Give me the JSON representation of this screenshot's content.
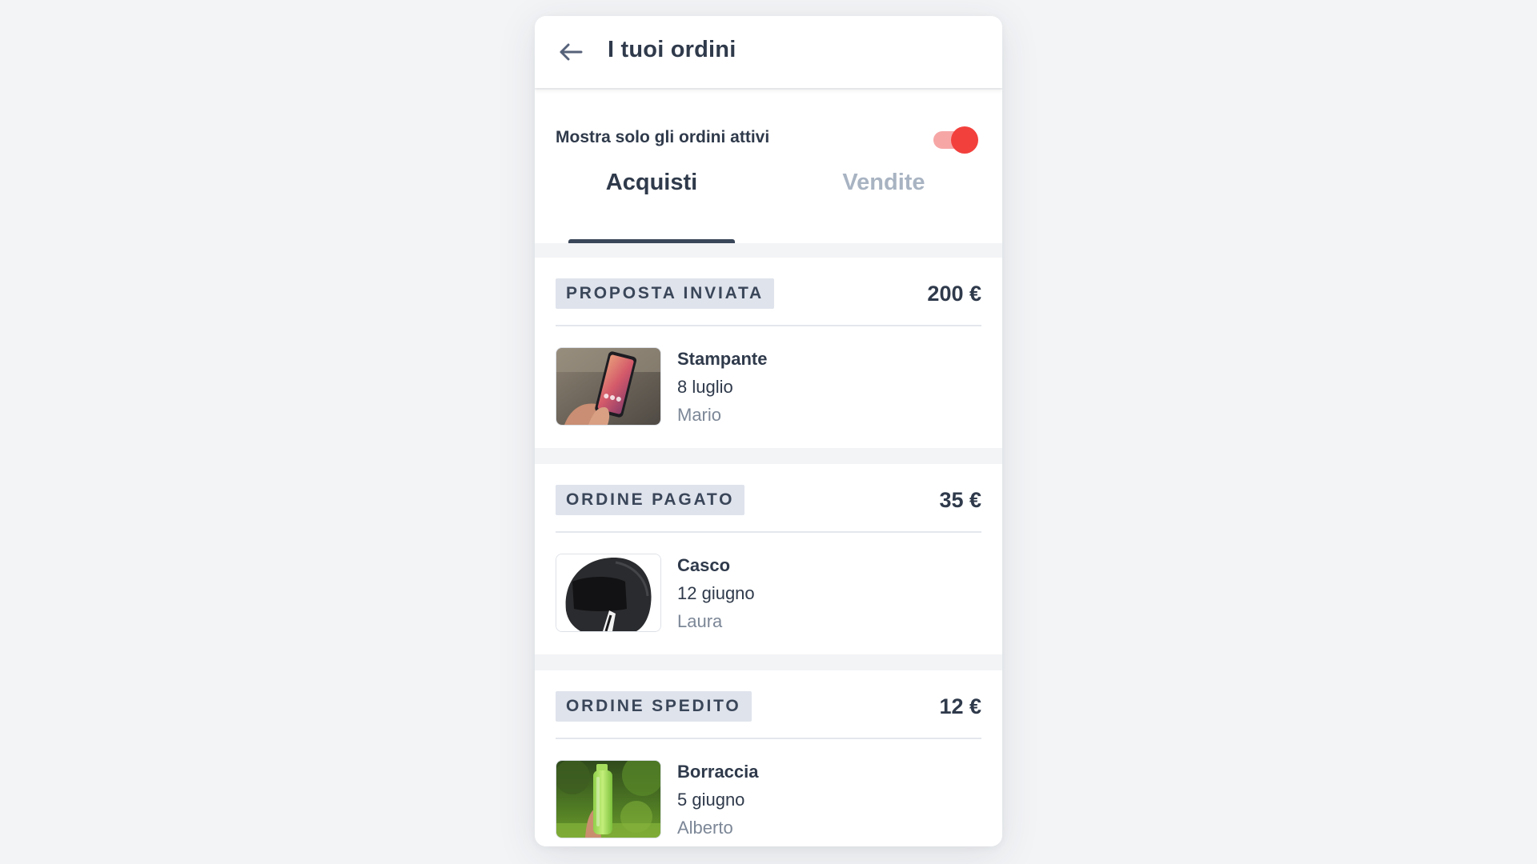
{
  "header": {
    "title": "I tuoi ordini",
    "back_icon": "arrow-left-icon"
  },
  "filter": {
    "active_only_label": "Mostra solo gli ordini attivi",
    "active_only_enabled": true,
    "toggle_color": "#f2403c"
  },
  "tabs": [
    {
      "label": "Acquisti",
      "selected": true
    },
    {
      "label": "Vendite",
      "selected": false
    }
  ],
  "orders": [
    {
      "status": "PROPOSTA INVIATA",
      "price": "200 €",
      "product": "Stampante",
      "date": "8 luglio",
      "seller": "Mario",
      "image": "smartphone-in-hand-photo"
    },
    {
      "status": "ORDINE PAGATO",
      "price": "35 €",
      "product": "Casco",
      "date": "12 giugno",
      "seller": "Laura",
      "image": "black-helmet-photo"
    },
    {
      "status": "ORDINE SPEDITO",
      "price": "12 €",
      "product": "Borraccia",
      "date": "5 giugno",
      "seller": "Alberto",
      "image": "green-bottle-photo"
    }
  ]
}
